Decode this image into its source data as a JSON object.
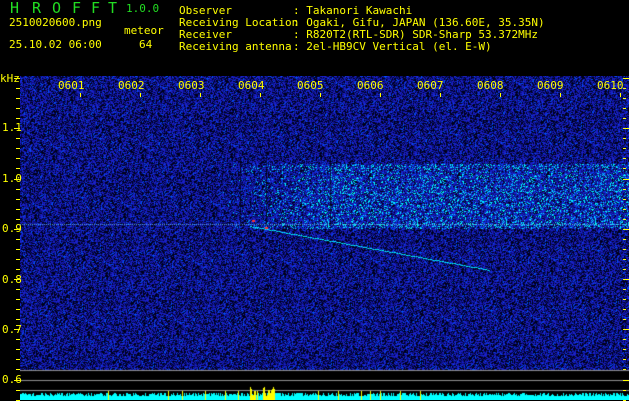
{
  "app": {
    "name_letters": [
      "H",
      "R",
      "O",
      "F",
      "F",
      "T"
    ],
    "version": "1.0.0"
  },
  "file": {
    "name": "2510020600.png",
    "datetime": "25.10.02 06:00"
  },
  "meteor": {
    "label": "meteor",
    "count": "64"
  },
  "info": [
    {
      "label": "Observer",
      "value": ": Takanori Kawachi"
    },
    {
      "label": "Receiving Location",
      "value": ": Ogaki, Gifu, JAPAN (136.60E, 35.35N)"
    },
    {
      "label": "Receiver",
      "value": ": R820T2(RTL-SDR) SDR-Sharp 53.372MHz"
    },
    {
      "label": "Receiving antenna",
      "value": ": 2el-HB9CV Vertical (el. E-W)"
    }
  ],
  "axis": {
    "unit": "kHz",
    "freq_labels": [
      "1.1",
      "1.0",
      "0.9",
      "0.8",
      "0.7",
      "0.6"
    ],
    "time_labels": [
      "0601",
      "0602",
      "0603",
      "0604",
      "0605",
      "0606",
      "0607",
      "0608",
      "0609",
      "0610"
    ]
  },
  "colors": {
    "text": "#ffff00",
    "logo": "#22dd22",
    "noise": "#1020c0",
    "level": "#00ffff",
    "meteor_bar": "#ffff00"
  }
}
